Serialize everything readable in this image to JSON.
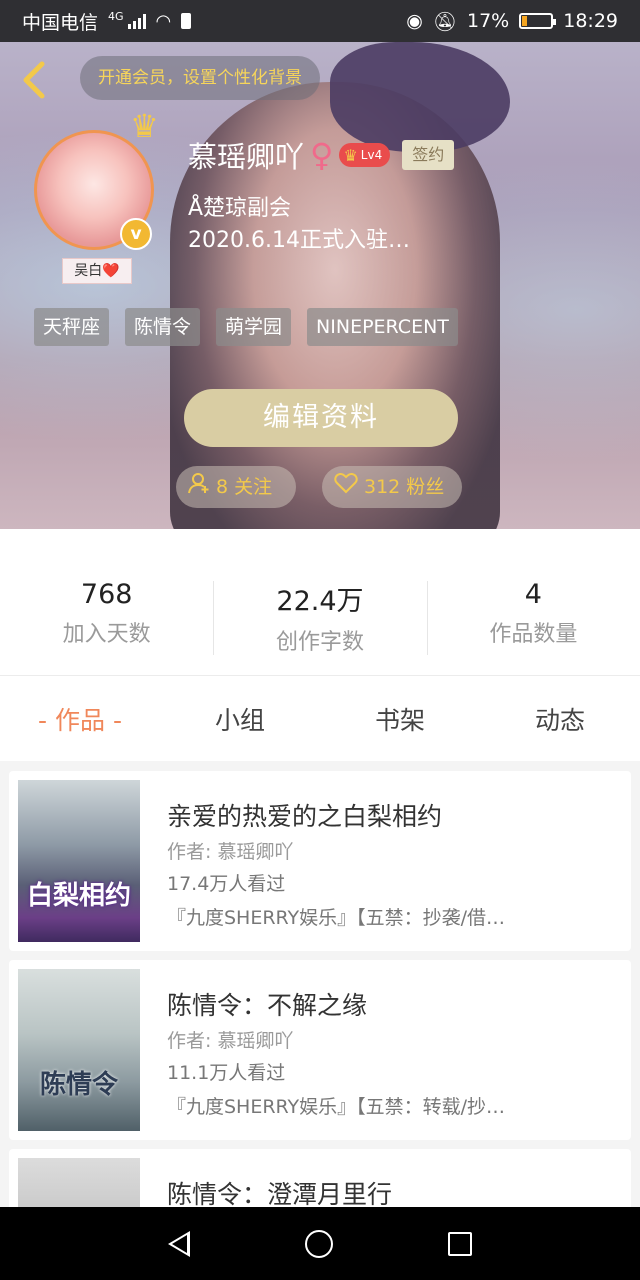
{
  "status_bar": {
    "carrier": "中国电信",
    "network": "4G",
    "battery": "17%",
    "battery_level": 0.17,
    "time": "18:29"
  },
  "header": {
    "vip_tip": "开通会员，设置个性化背景",
    "username": "慕瑶卿吖",
    "gender_symbol": "♀",
    "level": "Lv4",
    "sign_tag": "签约",
    "verified_mark": "v",
    "avatar_tag": "吴白❤️",
    "subtitle_1": "Å楚琼副会",
    "subtitle_2": "2020.6.14正式入驻…",
    "tags": [
      "天秤座",
      "陈情令",
      "萌学园",
      "NINEPERCENT"
    ],
    "edit_button": "编辑资料",
    "following": "8 关注",
    "followers": "312 粉丝"
  },
  "stats": [
    {
      "value": "768",
      "label": "加入天数"
    },
    {
      "value": "22.4万",
      "label": "创作字数"
    },
    {
      "value": "4",
      "label": "作品数量"
    }
  ],
  "tabs": [
    "- 作品 -",
    "小组",
    "书架",
    "动态"
  ],
  "works": [
    {
      "title": "亲爱的热爱的之白梨相约",
      "author": "作者: 慕瑶卿吖",
      "views": "17.4万人看过",
      "desc": "『九度SHERRY娱乐』【五禁：抄袭/借…",
      "cover_text": "白梨相约"
    },
    {
      "title": "陈情令：不解之缘",
      "author": "作者: 慕瑶卿吖",
      "views": "11.1万人看过",
      "desc": "『九度SHERRY娱乐』【五禁：转载/抄…",
      "cover_text": "陈情令"
    },
    {
      "title": "陈情令：澄潭月里行",
      "author": "",
      "views": "",
      "desc": "",
      "cover_text": ""
    }
  ],
  "colors": {
    "accent": "#f0875a",
    "gold": "#f3c94a",
    "edit_button_bg": "#d9cda3"
  }
}
